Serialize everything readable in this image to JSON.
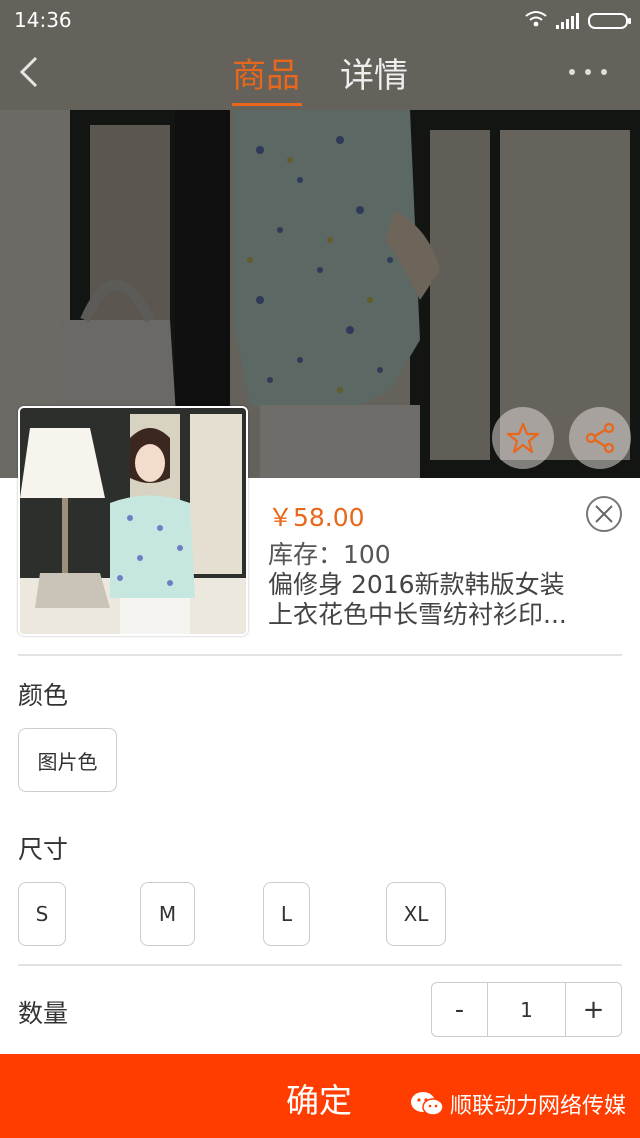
{
  "status_bar": {
    "time": "14:36"
  },
  "nav": {
    "tabs": [
      {
        "label": "商品"
      },
      {
        "label": "详情"
      }
    ]
  },
  "product": {
    "price": "￥58.00",
    "stock": "库存：100",
    "title_line1": "偏修身 2016新款韩版女装",
    "title_line2": "上衣花色中长雪纺衬衫印..."
  },
  "options": {
    "color": {
      "label": "颜色",
      "values": [
        "图片色"
      ]
    },
    "size": {
      "label": "尺寸",
      "values": [
        "S",
        "M",
        "L",
        "XL"
      ]
    }
  },
  "quantity": {
    "label": "数量",
    "minus": "-",
    "value": "1",
    "plus": "+"
  },
  "confirm_label": "确定",
  "watermark": "顺联动力网络传媒",
  "colors": {
    "accent": "#e8671a",
    "confirm_bg": "#ff3d00"
  }
}
